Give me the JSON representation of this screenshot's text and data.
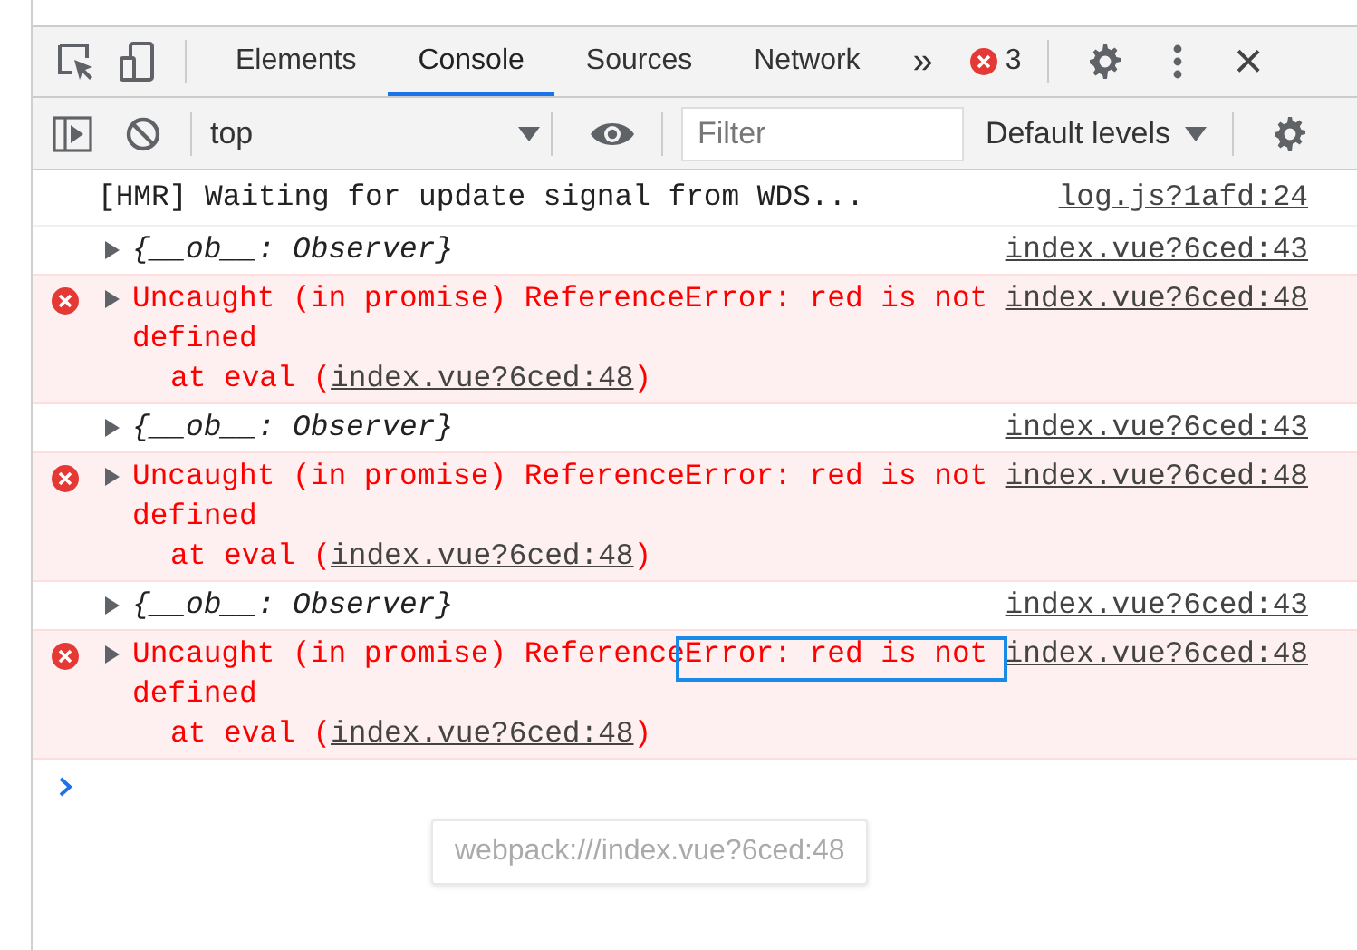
{
  "toolbar": {
    "tabs": [
      {
        "label": "Elements",
        "selected": false
      },
      {
        "label": "Console",
        "selected": true
      },
      {
        "label": "Sources",
        "selected": false
      },
      {
        "label": "Network",
        "selected": false
      }
    ],
    "more_tabs": "»",
    "error_count": "3",
    "close": "×"
  },
  "console_bar": {
    "context": "top",
    "filter": {
      "placeholder": "Filter"
    },
    "levels": "Default levels"
  },
  "messages": [
    {
      "kind": "log",
      "text": "[HMR] Waiting for update signal from WDS...",
      "source": "log.js?1afd:24",
      "highlighted": false
    },
    {
      "kind": "object",
      "text": "{__ob__: Observer}",
      "source": "index.vue?6ced:43",
      "highlighted": false
    },
    {
      "kind": "error",
      "text": "Uncaught (in promise) ReferenceError: red is not defined",
      "stack": "at eval (",
      "stack_link": "index.vue?6ced:48",
      "stack_end": ")",
      "source": "index.vue?6ced:48",
      "highlighted": false
    },
    {
      "kind": "object",
      "text": "{__ob__: Observer}",
      "source": "index.vue?6ced:43",
      "highlighted": false
    },
    {
      "kind": "error",
      "text": "Uncaught (in promise) ReferenceError: red is not defined",
      "stack": "at eval (",
      "stack_link": "index.vue?6ced:48",
      "stack_end": ")",
      "source": "index.vue?6ced:48",
      "highlighted": false
    },
    {
      "kind": "object",
      "text": "{__ob__: Observer}",
      "source": "index.vue?6ced:43",
      "highlighted": false
    },
    {
      "kind": "error",
      "text": "Uncaught (in promise) ReferenceError: red is not defined",
      "stack": "at eval (",
      "stack_link": "index.vue?6ced:48",
      "stack_end": ")",
      "source": "index.vue?6ced:48",
      "highlighted": true
    }
  ],
  "tooltip": "webpack:///index.vue?6ced:48"
}
